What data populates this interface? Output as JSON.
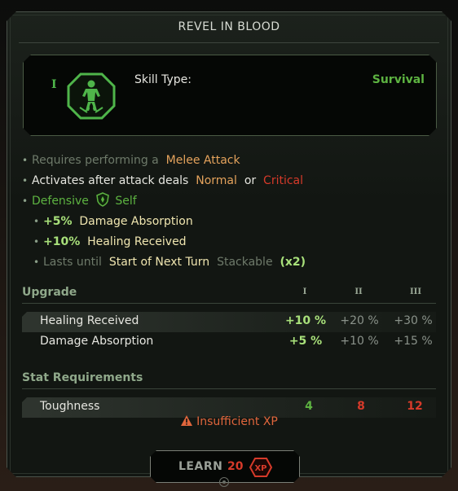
{
  "title": "REVEL IN BLOOD",
  "header": {
    "rank_marker": "I",
    "skill_icon": "figure-in-octagon-icon",
    "skill_type_label": "Skill Type:",
    "skill_type_value": "Survival"
  },
  "description": {
    "requires_prefix": "Requires performing a",
    "requires_value": "Melee Attack",
    "activates_prefix": "Activates after attack deals",
    "activates_normal": "Normal",
    "activates_or": "or",
    "activates_critical": "Critical",
    "defensive_label": "Defensive",
    "target_icon": "shield-icon",
    "target_label": "Self",
    "effects": [
      {
        "value": "+5%",
        "label": "Damage Absorption"
      },
      {
        "value": "+10%",
        "label": "Healing Received"
      }
    ],
    "duration_prefix": "Lasts until",
    "duration_value": "Start of Next Turn",
    "stackable_label": "Stackable",
    "stack_count": "(x2)"
  },
  "upgrade": {
    "heading": "Upgrade",
    "columns": [
      "I",
      "II",
      "III"
    ],
    "rows": [
      {
        "name": "Healing Received",
        "values": [
          "+10 %",
          "+20 %",
          "+30 %"
        ]
      },
      {
        "name": "Damage Absorption",
        "values": [
          "+5 %",
          "+10 %",
          "+15 %"
        ]
      }
    ]
  },
  "requirements": {
    "heading": "Stat Requirements",
    "rows": [
      {
        "name": "Toughness",
        "values": [
          "4",
          "8",
          "12"
        ]
      }
    ]
  },
  "warning": {
    "icon": "warning-triangle-icon",
    "text": "Insufficient XP"
  },
  "learn_button": {
    "label": "LEARN",
    "cost": "20",
    "cost_icon_text": "XP"
  },
  "colors": {
    "accent_green": "#5db341",
    "warning_red": "#d63a2a",
    "highlight_orange": "#e4a25c"
  }
}
